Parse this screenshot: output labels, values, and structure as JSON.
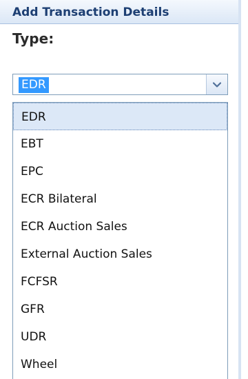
{
  "panel": {
    "title": "Add Transaction Details"
  },
  "form": {
    "type_label": "Type:",
    "type_value": "EDR"
  },
  "dropdown": {
    "options": [
      "EDR",
      "EBT",
      "EPC",
      "ECR Bilateral",
      "ECR Auction Sales",
      "External Auction Sales",
      "FCFSR",
      "GFR",
      "UDR",
      "Wheel"
    ],
    "selected_index": 0,
    "open": true
  },
  "colors": {
    "header_text": "#1d3f73",
    "selection": "#3399ff",
    "option_hover": "#dce8f7",
    "border": "#7e9db9"
  },
  "icons": {
    "combo_trigger": "chevron-down-icon"
  }
}
